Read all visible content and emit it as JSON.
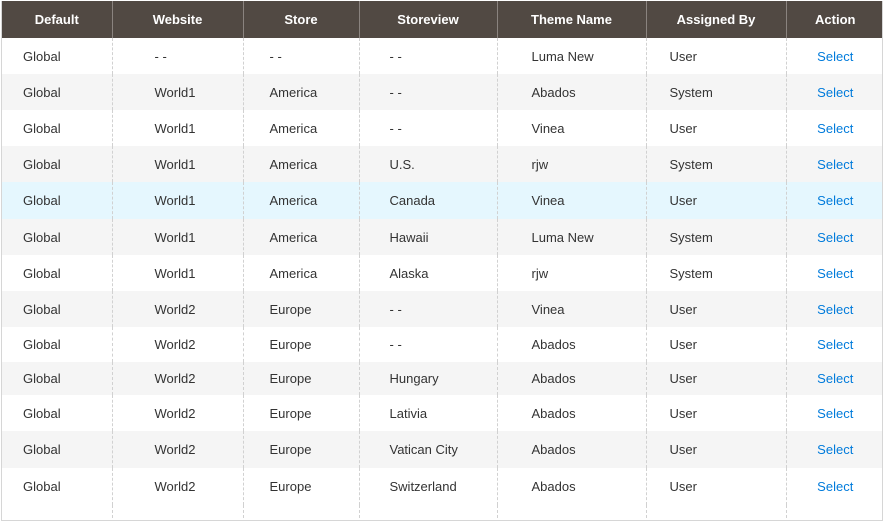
{
  "columns": [
    "Default",
    "Website",
    "Store",
    "Storeview",
    "Theme Name",
    "Assigned By",
    "Action"
  ],
  "rows": [
    {
      "default": "Global",
      "website": "- -",
      "store": "- -",
      "storeview": "- -",
      "theme": "Luma New",
      "assigned": "User",
      "action": "Select"
    },
    {
      "default": "Global",
      "website": "World1",
      "store": "America",
      "storeview": "- -",
      "theme": "Abados",
      "assigned": "System",
      "action": "Select"
    },
    {
      "default": "Global",
      "website": "World1",
      "store": "America",
      "storeview": "- -",
      "theme": "Vinea",
      "assigned": "User",
      "action": "Select"
    },
    {
      "default": "Global",
      "website": "World1",
      "store": "America",
      "storeview": "U.S.",
      "theme": "rjw",
      "assigned": "System",
      "action": "Select"
    },
    {
      "default": "Global",
      "website": "World1",
      "store": "America",
      "storeview": "Canada",
      "theme": "Vinea",
      "assigned": "User",
      "action": "Select"
    },
    {
      "default": "Global",
      "website": "World1",
      "store": "America",
      "storeview": "Hawaii",
      "theme": "Luma New",
      "assigned": "System",
      "action": "Select"
    },
    {
      "default": "Global",
      "website": "World1",
      "store": "America",
      "storeview": "Alaska",
      "theme": "rjw",
      "assigned": "System",
      "action": "Select"
    },
    {
      "default": "Global",
      "website": "World2",
      "store": "Europe",
      "storeview": "- -",
      "theme": "Vinea",
      "assigned": "User",
      "action": "Select"
    },
    {
      "default": "Global",
      "website": "World2",
      "store": "Europe",
      "storeview": "- -",
      "theme": "Abados",
      "assigned": "User",
      "action": "Select"
    },
    {
      "default": "Global",
      "website": "World2",
      "store": "Europe",
      "storeview": "Hungary",
      "theme": "Abados",
      "assigned": "User",
      "action": "Select"
    },
    {
      "default": "Global",
      "website": "World2",
      "store": "Europe",
      "storeview": "Lativia",
      "theme": "Abados",
      "assigned": "User",
      "action": "Select"
    },
    {
      "default": "Global",
      "website": "World2",
      "store": "Europe",
      "storeview": "Vatican City",
      "theme": "Abados",
      "assigned": "User",
      "action": "Select"
    },
    {
      "default": "Global",
      "website": "World2",
      "store": "Europe",
      "storeview": "Switzerland",
      "theme": "Abados",
      "assigned": "User",
      "action": "Select"
    }
  ],
  "colors": {
    "header_bg": "#514943",
    "header_text": "#ffffff",
    "link": "#007bdb",
    "row_alt": "#f5f5f5",
    "row_highlight": "#e5f7fe"
  }
}
